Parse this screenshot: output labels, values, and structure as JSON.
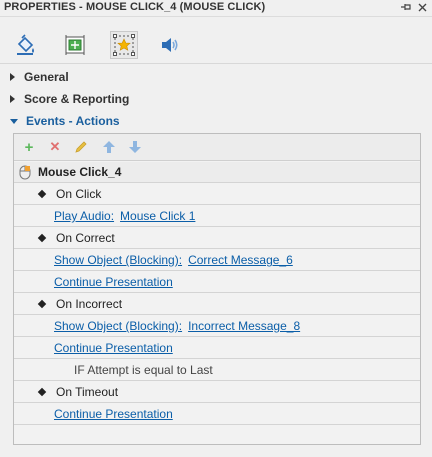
{
  "panel": {
    "title": "PROPERTIES - MOUSE CLICK_4 (MOUSE CLICK)",
    "pin_icon": "pin-icon",
    "close_icon": "close-icon"
  },
  "toolbar": {
    "tools": [
      {
        "name": "fill-bucket-icon"
      },
      {
        "name": "size-position-icon"
      },
      {
        "name": "events-star-icon"
      },
      {
        "name": "audio-speaker-icon"
      }
    ]
  },
  "sections": {
    "general": "General",
    "score": "Score & Reporting",
    "events": "Events - Actions"
  },
  "events_toolbar": {
    "add": "+",
    "delete": "✕",
    "edit": "edit-pencil-icon",
    "move_up": "arrow-up-icon",
    "move_down": "arrow-down-icon"
  },
  "tree": {
    "object_name": "Mouse Click_4",
    "on_click": "On Click",
    "play_audio_label": "Play Audio:",
    "play_audio_target": "Mouse Click 1",
    "on_correct": "On Correct",
    "show_object_label": "Show Object (Blocking):",
    "correct_target": "Correct Message_6",
    "continue_1": "Continue Presentation",
    "on_incorrect": "On Incorrect",
    "show_object_label_2": "Show Object (Blocking):",
    "incorrect_target": "Incorrect Message_8",
    "continue_2": "Continue Presentation",
    "condition": "IF Attempt is equal to Last",
    "on_timeout": "On Timeout",
    "continue_3": "Continue Presentation"
  },
  "colors": {
    "link": "#0b5ea8",
    "section_open": "#1a5f9e",
    "add_green": "#5cb85c",
    "delete_red": "#e07070",
    "edit_yellow": "#e8c040",
    "arrow_blue": "#8fb6e0"
  }
}
